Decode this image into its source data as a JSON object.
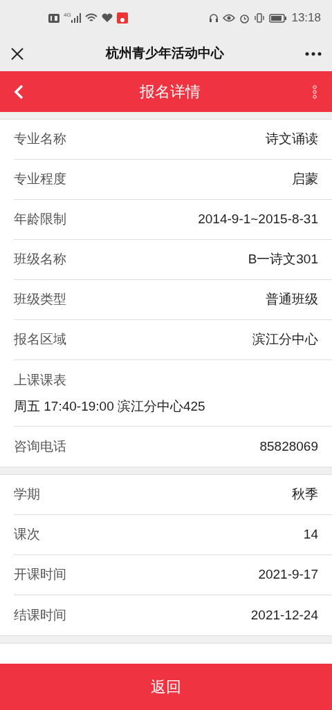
{
  "status_bar": {
    "time": "13:18",
    "network": "4G"
  },
  "nav_bar": {
    "title": "杭州青少年活动中心"
  },
  "header": {
    "title": "报名详情"
  },
  "sections": [
    {
      "rows": [
        {
          "kind": "inline",
          "label": "专业名称",
          "value": "诗文诵读"
        },
        {
          "kind": "inline",
          "label": "专业程度",
          "value": "启蒙"
        },
        {
          "kind": "inline",
          "label": "年龄限制",
          "value": "2014-9-1~2015-8-31"
        },
        {
          "kind": "inline",
          "label": "班级名称",
          "value": "B一诗文301"
        },
        {
          "kind": "inline",
          "label": "班级类型",
          "value": "普通班级"
        },
        {
          "kind": "inline",
          "label": "报名区域",
          "value": "滨江分中心"
        },
        {
          "kind": "stacked",
          "label": "上课课表",
          "value": "周五 17:40-19:00 滨江分中心425"
        },
        {
          "kind": "inline",
          "label": "咨询电话",
          "value": "85828069"
        }
      ]
    },
    {
      "rows": [
        {
          "kind": "inline",
          "label": "学期",
          "value": "秋季"
        },
        {
          "kind": "inline",
          "label": "课次",
          "value": "14"
        },
        {
          "kind": "inline",
          "label": "开课时间",
          "value": "2021-9-17"
        },
        {
          "kind": "inline",
          "label": "结课时间",
          "value": "2021-12-24"
        }
      ]
    }
  ],
  "footer_button": "返回"
}
